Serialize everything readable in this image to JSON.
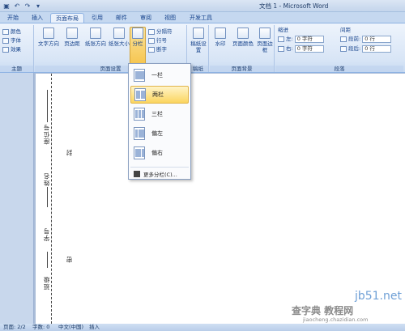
{
  "window": {
    "title": "文档 1 - Microsoft Word",
    "quick_access": [
      "save-icon",
      "undo-icon",
      "redo-icon",
      "customize-icon"
    ]
  },
  "tabs": [
    {
      "label": "开始",
      "active": false
    },
    {
      "label": "插入",
      "active": false
    },
    {
      "label": "页面布局",
      "active": true
    },
    {
      "label": "引用",
      "active": false
    },
    {
      "label": "邮件",
      "active": false
    },
    {
      "label": "审阅",
      "active": false
    },
    {
      "label": "视图",
      "active": false
    },
    {
      "label": "开发工具",
      "active": false
    }
  ],
  "ribbon": {
    "theme": {
      "label": "主题",
      "colors": "颜色",
      "fonts": "字体",
      "effects": "效果"
    },
    "page_setup": {
      "label": "页面设置",
      "text_direction": "文字方向",
      "margins": "页边距",
      "orientation": "纸张方向",
      "size": "纸张大小",
      "columns": "分栏",
      "breaks": "分隔符",
      "line_numbers": "行号",
      "hyphenation": "断字"
    },
    "draft": {
      "label": "稿纸",
      "draft_settings": "稿纸设置"
    },
    "page_background": {
      "label": "页面背景",
      "watermark": "水印",
      "page_color": "页面颜色",
      "page_borders": "页面边框"
    },
    "paragraph": {
      "label": "段落",
      "indent_title": "缩进",
      "spacing_title": "间距",
      "indent_left_label": "左:",
      "indent_left_value": "0 字符",
      "indent_right_label": "右:",
      "indent_right_value": "0 字符",
      "spacing_before_label": "段前:",
      "spacing_before_value": "0 行",
      "spacing_after_label": "段后:",
      "spacing_after_value": "0 行"
    }
  },
  "columns_menu": {
    "items": [
      {
        "label": "一栏",
        "highlighted": false
      },
      {
        "label": "两栏",
        "highlighted": true
      },
      {
        "label": "三栏",
        "highlighted": false
      },
      {
        "label": "偏左",
        "highlighted": false
      },
      {
        "label": "偏右",
        "highlighted": false
      }
    ],
    "more": "更多分栏(C)..."
  },
  "document": {
    "labels": [
      "座位号",
      "封",
      "姓名",
      "学号",
      "密",
      "班级"
    ]
  },
  "status_bar": {
    "page": "页面: 2/2",
    "word_count": "字数: 0",
    "language": "中文(中国)",
    "mode": "插入"
  },
  "watermark": {
    "site": "jb51.net",
    "brand": "查字典 教程网",
    "url": "jiaocheng.chazidian.com"
  },
  "colors": {
    "ribbon_bg": "#dbe7f6",
    "highlight": "#f9d262",
    "document_bg": "#a9bcd8"
  }
}
